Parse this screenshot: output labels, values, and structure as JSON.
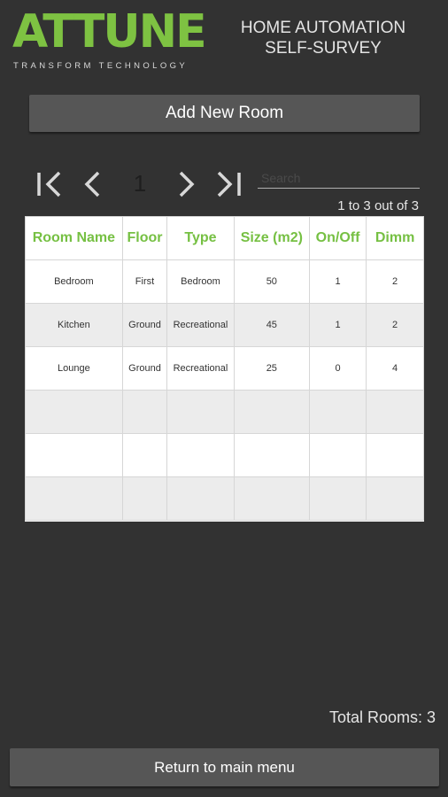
{
  "brand": {
    "name": "ATTUNE",
    "tagline": "TRANSFORM TECHNOLOGY",
    "color": "#7ec242"
  },
  "header": {
    "line1": "HOME AUTOMATION",
    "line2": "SELF-SURVEY"
  },
  "actions": {
    "add_room": "Add New Room",
    "return_menu": "Return to main menu"
  },
  "pager": {
    "current_page": "1",
    "range_text": "1 to 3 out of 3",
    "icons": [
      "first-page-icon",
      "previous-page-icon",
      "next-page-icon",
      "last-page-icon"
    ]
  },
  "search": {
    "placeholder": "Search",
    "value": ""
  },
  "table": {
    "columns": [
      "Room Name",
      "Floor",
      "Type",
      "Size (m2)",
      "On/Off",
      "Dimm"
    ],
    "rows": [
      [
        "Bedroom",
        "First",
        "Bedroom",
        "50",
        "1",
        "2"
      ],
      [
        "Kitchen",
        "Ground",
        "Recreational",
        "45",
        "1",
        "2"
      ],
      [
        "Lounge",
        "Ground",
        "Recreational",
        "25",
        "0",
        "4"
      ],
      [
        "",
        "",
        "",
        "",
        "",
        ""
      ],
      [
        "",
        "",
        "",
        "",
        "",
        ""
      ],
      [
        "",
        "",
        "",
        "",
        "",
        ""
      ]
    ]
  },
  "footer": {
    "total_rooms": "Total Rooms: 3"
  },
  "colors": {
    "background": "#323232",
    "accent": "#76c043",
    "button": "#565656"
  }
}
